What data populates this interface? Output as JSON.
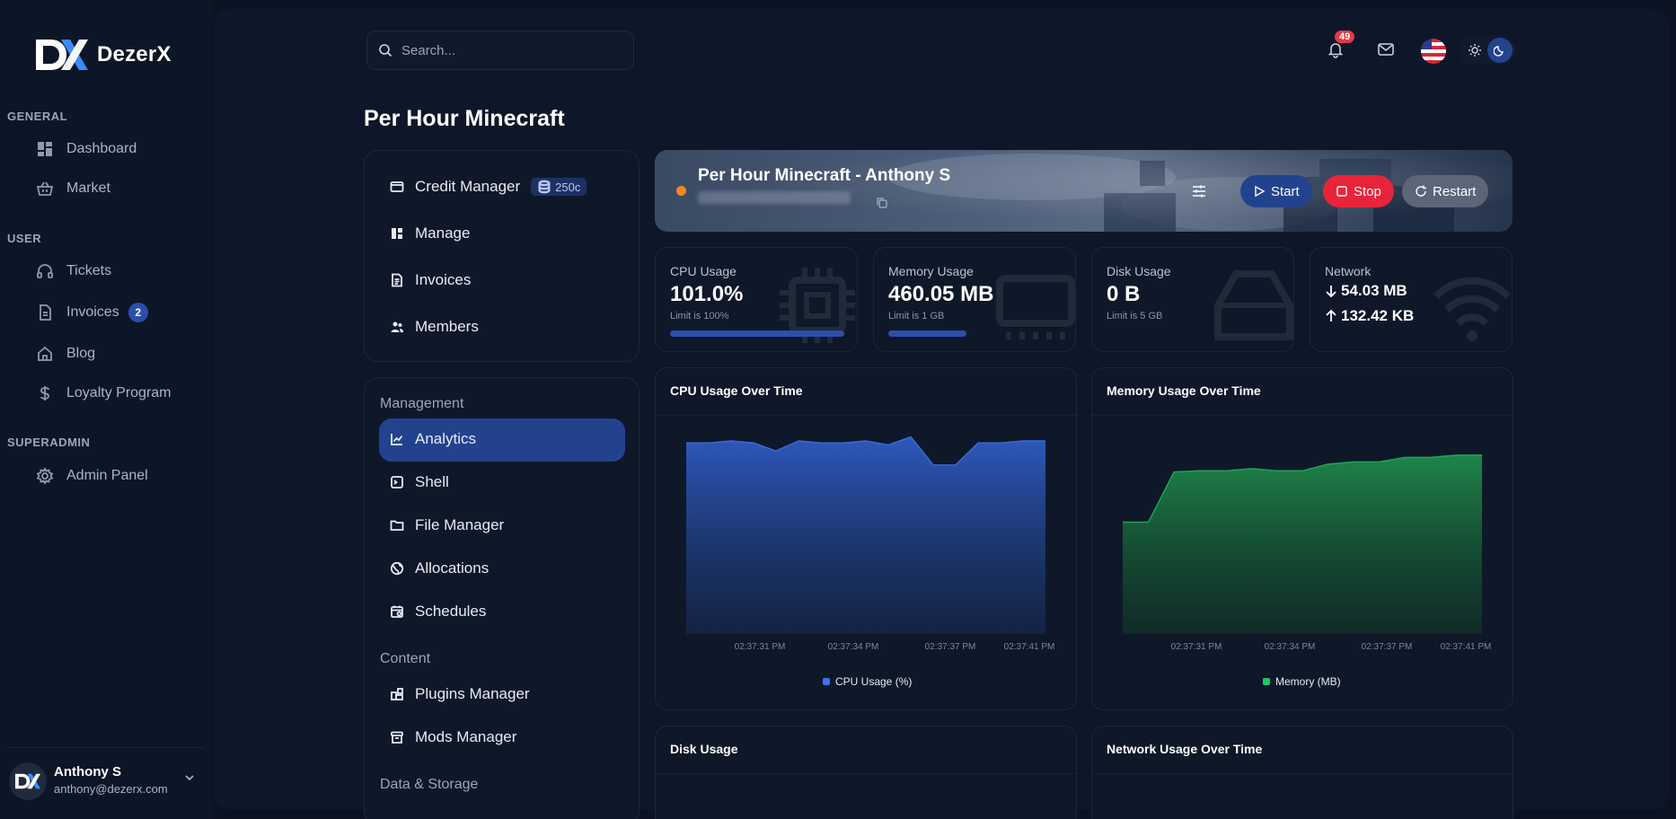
{
  "brand": {
    "name": "DezerX"
  },
  "sidebar": {
    "sections": [
      {
        "title": "GENERAL"
      },
      {
        "title": "USER"
      },
      {
        "title": "SUPERADMIN"
      }
    ],
    "items": [
      {
        "label": "Dashboard",
        "icon": "dashboard-icon"
      },
      {
        "label": "Market",
        "icon": "basket-icon"
      },
      {
        "label": "Tickets",
        "icon": "headset-icon"
      },
      {
        "label": "Invoices",
        "icon": "document-icon",
        "badge": "2"
      },
      {
        "label": "Blog",
        "icon": "home-icon"
      },
      {
        "label": "Loyalty Program",
        "icon": "dollar-icon"
      },
      {
        "label": "Admin Panel",
        "icon": "gear-icon"
      }
    ],
    "user": {
      "name": "Anthony S",
      "email": "anthony@dezerx.com"
    }
  },
  "topbar": {
    "search_placeholder": "Search...",
    "notification_count": "49"
  },
  "page": {
    "title": "Per Hour Minecraft"
  },
  "server_menu": {
    "top_items": [
      {
        "label": "Credit Manager",
        "badge": "250c",
        "icon": "wallet-icon"
      },
      {
        "label": "Manage",
        "icon": "layout-icon"
      },
      {
        "label": "Invoices",
        "icon": "receipt-icon"
      },
      {
        "label": "Members",
        "icon": "users-icon"
      }
    ],
    "groups": [
      {
        "title": "Management"
      },
      {
        "title": "Content"
      },
      {
        "title": "Data & Storage"
      }
    ],
    "management_items": [
      {
        "label": "Analytics",
        "icon": "chart-icon",
        "active": true
      },
      {
        "label": "Shell",
        "icon": "terminal-icon"
      },
      {
        "label": "File Manager",
        "icon": "folder-icon"
      },
      {
        "label": "Allocations",
        "icon": "globe-icon"
      },
      {
        "label": "Schedules",
        "icon": "calendar-icon"
      }
    ],
    "content_items": [
      {
        "label": "Plugins Manager",
        "icon": "puzzle-icon"
      },
      {
        "label": "Mods Manager",
        "icon": "archive-icon"
      }
    ]
  },
  "server": {
    "name": "Per Hour Minecraft - Anthony S",
    "status_color": "#f08a20",
    "buttons": {
      "start": "Start",
      "stop": "Stop",
      "restart": "Restart"
    }
  },
  "stats": {
    "cpu": {
      "label": "CPU Usage",
      "value": "101.0%",
      "limit": "Limit is 100%",
      "fill": 1.0
    },
    "memory": {
      "label": "Memory Usage",
      "value": "460.05 MB",
      "limit": "Limit is 1 GB",
      "fill": 0.45
    },
    "disk": {
      "label": "Disk Usage",
      "value": "0 B",
      "limit": "Limit is 5 GB",
      "fill": 0
    },
    "network": {
      "label": "Network",
      "down": "54.03 MB",
      "up": "132.42 KB"
    }
  },
  "chart_data": [
    {
      "type": "area",
      "title": "CPU Usage Over Time",
      "x": [
        "02:37:31 PM",
        "02:37:34 PM",
        "02:37:37 PM",
        "02:37:41 PM"
      ],
      "series": [
        {
          "name": "CPU Usage (%)",
          "color": "#2f5cc4",
          "values": [
            95,
            95,
            96,
            95,
            91,
            96,
            95,
            95,
            96,
            94,
            98,
            84,
            84,
            95,
            95,
            96,
            96
          ]
        }
      ],
      "ylim": [
        0,
        100
      ]
    },
    {
      "type": "area",
      "title": "Memory Usage Over Time",
      "x": [
        "02:37:31 PM",
        "02:37:34 PM",
        "02:37:37 PM",
        "02:37:41 PM"
      ],
      "series": [
        {
          "name": "Memory (MB)",
          "color": "#1f7a43",
          "values": [
            400,
            400,
            445,
            446,
            446,
            448,
            446,
            446,
            452,
            454,
            454,
            458,
            458,
            460,
            460
          ]
        }
      ],
      "ylim": [
        300,
        480
      ]
    },
    {
      "type": "area",
      "title": "Disk Usage"
    },
    {
      "type": "area",
      "title": "Network Usage Over Time"
    }
  ]
}
